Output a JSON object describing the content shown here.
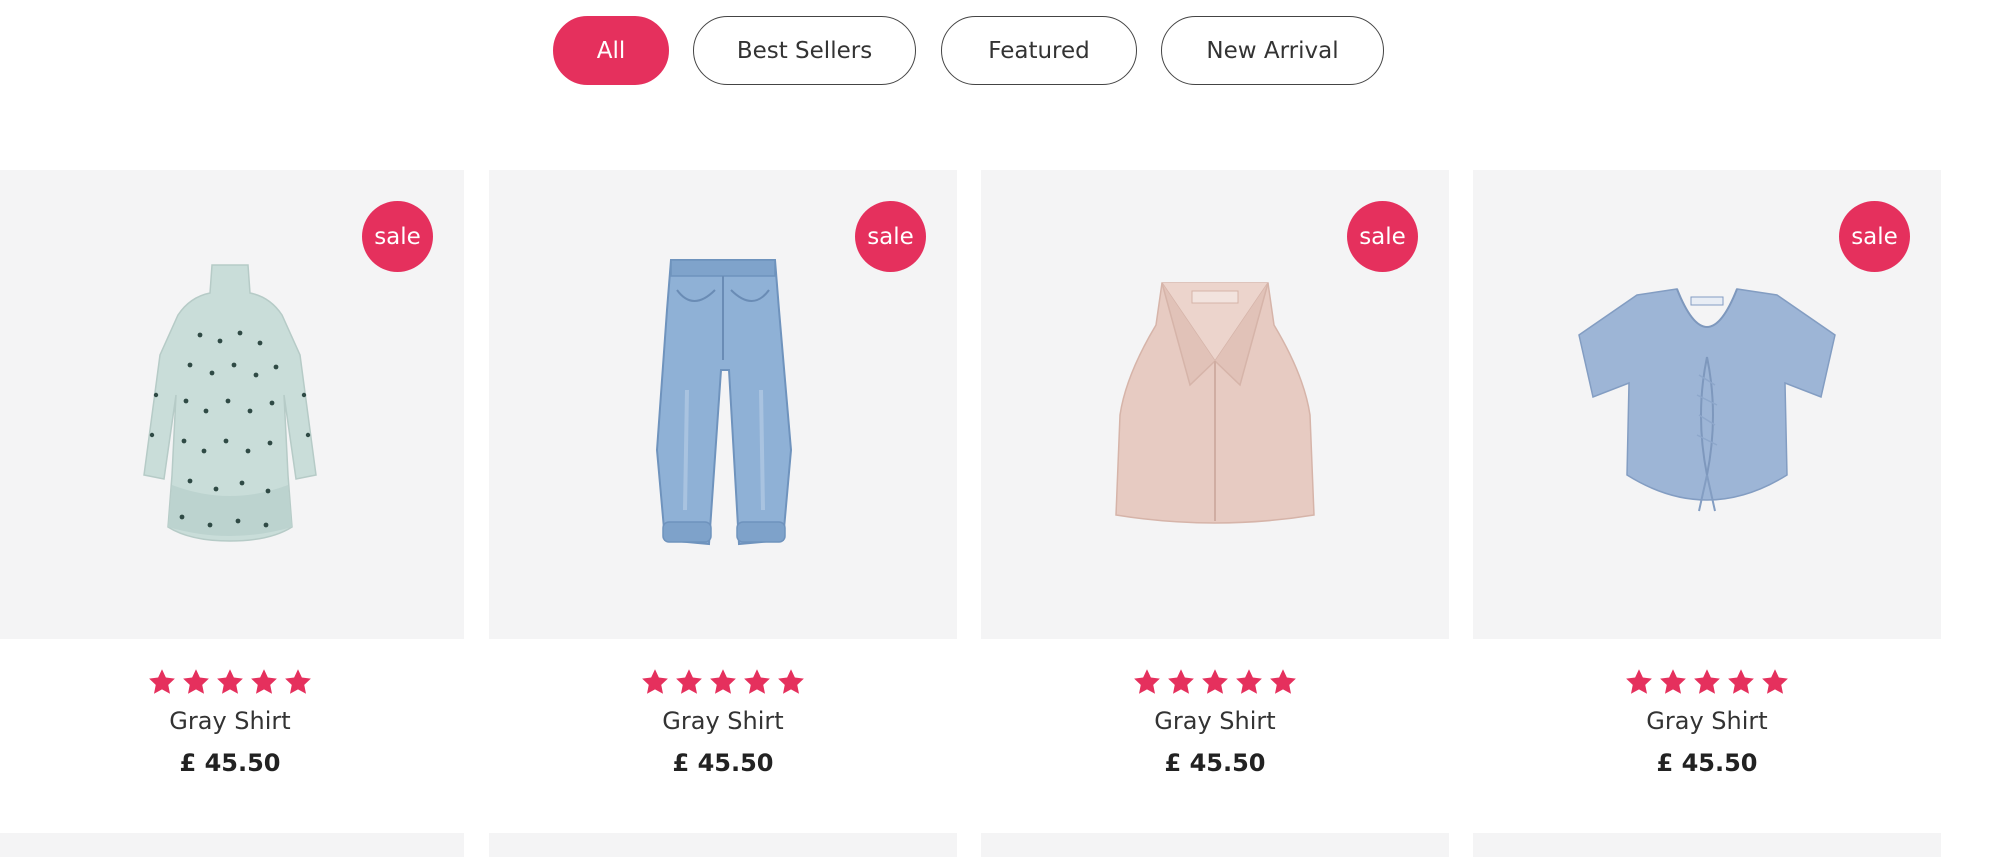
{
  "filters": {
    "all": "All",
    "best_sellers": "Best Sellers",
    "featured": "Featured",
    "new_arrival": "New Arrival",
    "active": "All"
  },
  "products": [
    {
      "badge": "sale",
      "rating": 5,
      "name": "Gray Shirt",
      "price": "£ 45.50",
      "image_icon": "dress-image-icon"
    },
    {
      "badge": "sale",
      "rating": 5,
      "name": "Gray Shirt",
      "price": "£ 45.50",
      "image_icon": "jeans-image-icon"
    },
    {
      "badge": "sale",
      "rating": 5,
      "name": "Gray Shirt",
      "price": "£ 45.50",
      "image_icon": "halter-top-image-icon"
    },
    {
      "badge": "sale",
      "rating": 5,
      "name": "Gray Shirt",
      "price": "£ 45.50",
      "image_icon": "crop-top-image-icon"
    }
  ],
  "colors": {
    "accent": "#e5305d",
    "card_bg": "#f4f4f5"
  }
}
